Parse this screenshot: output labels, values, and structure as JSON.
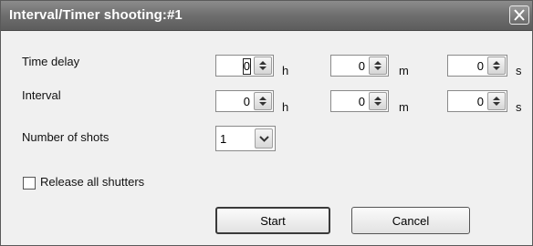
{
  "window": {
    "title": "Interval/Timer shooting:#1"
  },
  "rows": {
    "time_delay": {
      "label": "Time delay",
      "hours": "0",
      "minutes": "0",
      "seconds": "0"
    },
    "interval": {
      "label": "Interval",
      "hours": "0",
      "minutes": "0",
      "seconds": "0"
    }
  },
  "units": {
    "h": "h",
    "m": "m",
    "s": "s"
  },
  "shots": {
    "label": "Number of shots",
    "value": "1"
  },
  "release_all": {
    "label": "Release all shutters",
    "checked": false
  },
  "buttons": {
    "start": "Start",
    "cancel": "Cancel"
  },
  "icons": {
    "close": "close-icon",
    "spin": "spin-arrows-icon",
    "dropdown": "chevron-down-icon"
  }
}
